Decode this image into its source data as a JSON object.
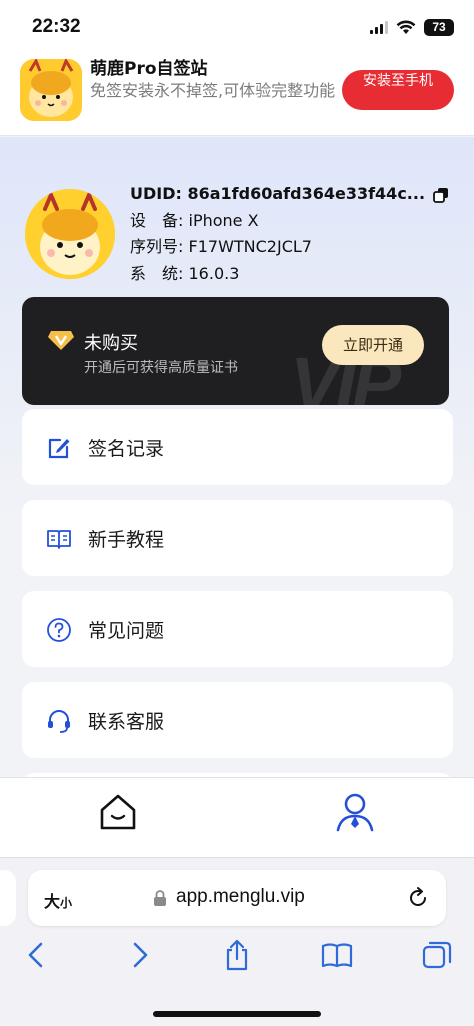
{
  "status_bar": {
    "time": "22:32",
    "battery": "73"
  },
  "banner": {
    "title": "萌鹿Pro自签站",
    "description": "免签安装永不掉签,可体验完整功能",
    "install_button": "安装至手机"
  },
  "profile": {
    "udid_label": "UDID:",
    "udid_value": "86a1fd60afd364e33f44c...",
    "device_label": "设　备:",
    "device_value": "iPhone X",
    "serial_label": "序列号:",
    "serial_value": "F17WTNC2JCL7",
    "system_label": "系　统:",
    "system_value": "16.0.3"
  },
  "vip_card": {
    "title": "未购买",
    "subtitle": "开通后可获得高质量证书",
    "button": "立即开通"
  },
  "menu": [
    {
      "label": "签名记录",
      "icon": "edit-icon"
    },
    {
      "label": "新手教程",
      "icon": "book-icon"
    },
    {
      "label": "常见问题",
      "icon": "question-icon"
    },
    {
      "label": "联系客服",
      "icon": "headset-icon"
    }
  ],
  "tabbar": {
    "home_icon": "home-icon",
    "profile_icon": "user-icon",
    "active_color": "#2450d8"
  },
  "safari": {
    "text_size_big": "大",
    "text_size_small": "小",
    "url": "app.menglu.vip"
  },
  "colors": {
    "brand_red": "#e82c33",
    "accent_blue": "#2450d8",
    "vip_gold": "#fbe7bd"
  }
}
